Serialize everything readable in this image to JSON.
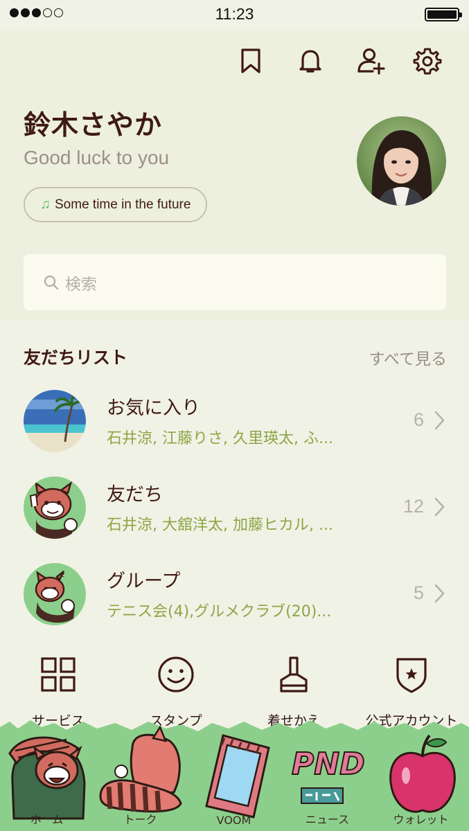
{
  "status_bar": {
    "time": "11:23"
  },
  "toolbar": {
    "bookmark_icon": "bookmark-icon",
    "bell_icon": "bell-icon",
    "add_friend_icon": "add-friend-icon",
    "settings_icon": "gear-icon"
  },
  "profile": {
    "name": "鈴木さやか",
    "status_message": "Good luck to you",
    "music": "Some time in the future"
  },
  "search": {
    "placeholder": "検索"
  },
  "friends_section": {
    "title": "友だちリスト",
    "see_all": "すべて見る",
    "items": [
      {
        "title": "お気に入り",
        "subtitle": "石井涼, 江藤りさ, 久里瑛太, ふ...",
        "count": "6"
      },
      {
        "title": "友だち",
        "subtitle": "石井涼, 大舘洋太, 加藤ヒカル, ...",
        "count": "12"
      },
      {
        "title": "グループ",
        "subtitle": "テニス会(4),グルメクラブ(20)...",
        "count": "5"
      }
    ]
  },
  "shortcuts": [
    {
      "label": "サービス",
      "icon": "grid-icon"
    },
    {
      "label": "スタンプ",
      "icon": "smiley-icon"
    },
    {
      "label": "着せかえ",
      "icon": "brush-icon"
    },
    {
      "label": "公式アカウント",
      "icon": "shield-star-icon"
    }
  ],
  "tabs": [
    {
      "label": "ホーム"
    },
    {
      "label": "トーク"
    },
    {
      "label": "VOOM"
    },
    {
      "label": "ニュース"
    },
    {
      "label": "ウォレット"
    }
  ],
  "colors": {
    "background": "#f1f2e6",
    "text_primary": "#3f1a12",
    "subtitle_green": "#8ea545",
    "tabbar_green": "#8ccf8c"
  }
}
